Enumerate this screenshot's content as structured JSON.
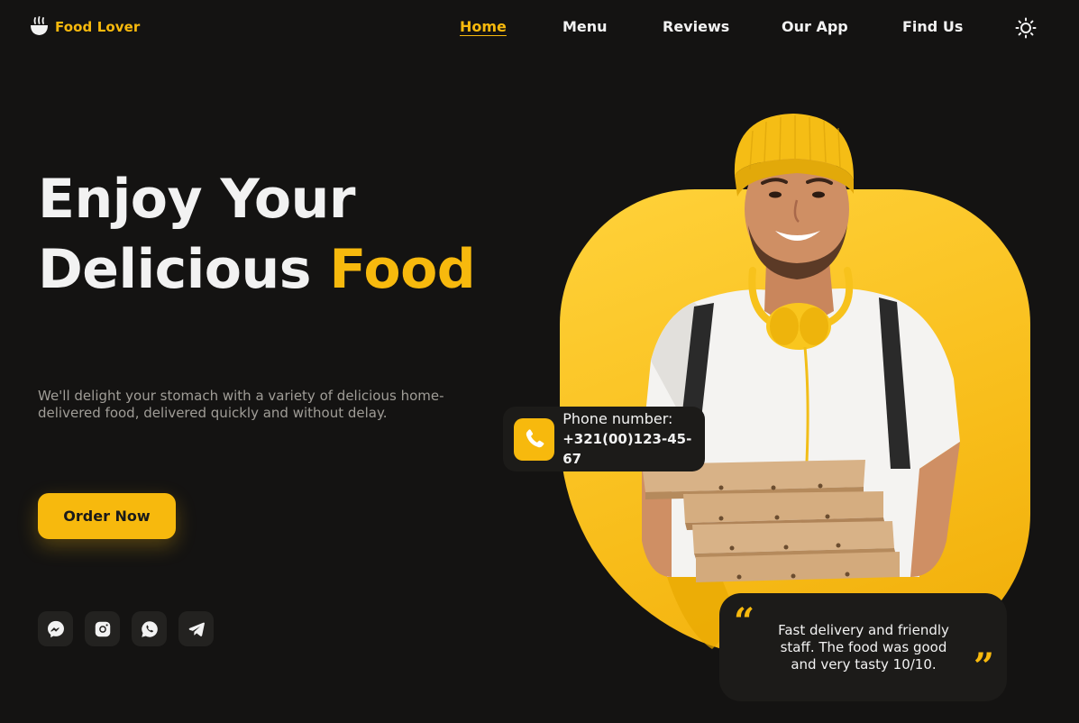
{
  "brand": {
    "name": "Food Lover",
    "icon": "food-bowl-icon"
  },
  "nav": {
    "items": [
      {
        "label": "Home",
        "active": true
      },
      {
        "label": "Menu",
        "active": false
      },
      {
        "label": "Reviews",
        "active": false
      },
      {
        "label": "Our App",
        "active": false
      },
      {
        "label": "Find Us",
        "active": false
      }
    ],
    "theme_toggle_icon": "sun-icon"
  },
  "hero": {
    "title_line1": "Enjoy Your",
    "title_line2_prefix": "Delicious ",
    "title_line2_accent": "Food",
    "description": "We'll delight your stomach with a variety of delicious home-delivered food, delivered quickly and without delay.",
    "order_button": "Order Now"
  },
  "socials": [
    {
      "icon": "messenger-icon"
    },
    {
      "icon": "instagram-icon"
    },
    {
      "icon": "whatsapp-icon"
    },
    {
      "icon": "telegram-icon"
    }
  ],
  "phone_card": {
    "label": "Phone number:",
    "number": "+321(00)123-45-67",
    "icon": "phone-icon"
  },
  "review": {
    "text": "Fast delivery and friendly staff. The food was good and very tasty 10/10.",
    "open_quote": "“",
    "close_quote": "”"
  },
  "colors": {
    "accent": "#f7b90d",
    "background": "#141312",
    "card": "#1c1b19",
    "text": "#f2f2f2",
    "muted": "#a09d97"
  }
}
